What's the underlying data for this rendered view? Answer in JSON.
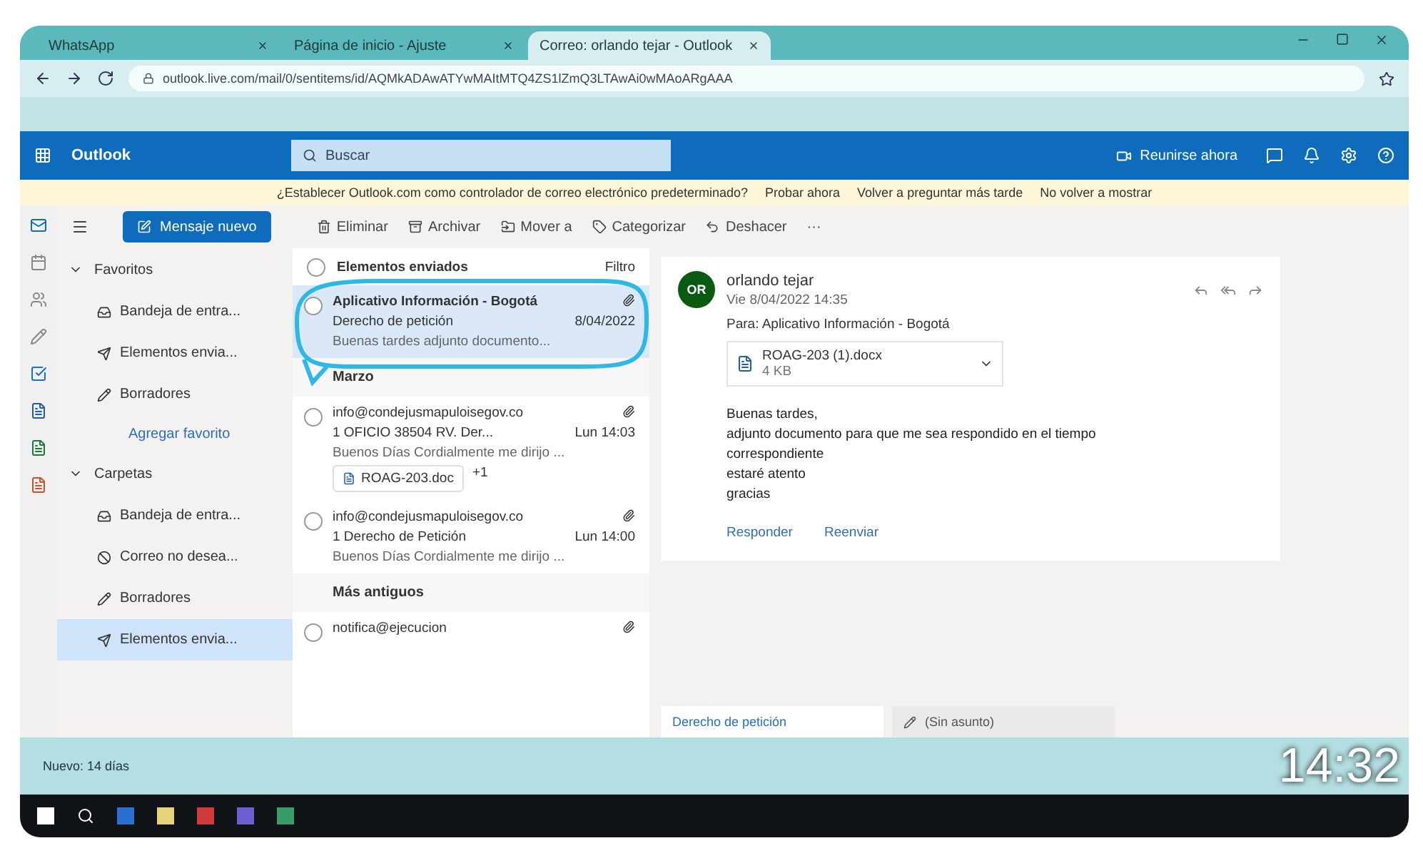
{
  "browser": {
    "tabs": [
      {
        "label": "WhatsApp",
        "selected": false
      },
      {
        "label": "Página de inicio - Ajuste",
        "selected": false
      },
      {
        "label": "Correo: orlando tejar - Outlook",
        "selected": true
      }
    ],
    "address": "outlook.live.com/mail/0/sentitems/id/AQMkADAwATYwMAItMTQ4ZS1lZmQ3LTAwAi0wMAoARgAAA"
  },
  "header": {
    "app_name": "Outlook",
    "search_placeholder": "Buscar",
    "meet_label": "Reunirse ahora"
  },
  "banner": {
    "message": "¿Establecer Outlook.com como controlador de correo electrónico predeterminado?",
    "actions": [
      "Probar ahora",
      "Volver a preguntar más tarde",
      "No volver a mostrar"
    ]
  },
  "toolbar": {
    "new_message": "Mensaje nuevo",
    "actions": [
      "Eliminar",
      "Archivar",
      "Mover a",
      "Categorizar",
      "Deshacer"
    ],
    "more": "···"
  },
  "folder_sections": [
    {
      "title": "Favoritos",
      "expanded": true,
      "items": [
        {
          "label": "Bandeja de entra...",
          "selected": false
        },
        {
          "label": "Elementos envia...",
          "selected": false
        },
        {
          "label": "Borradores",
          "selected": false
        }
      ],
      "link": "Agregar favorito"
    },
    {
      "title": "Carpetas",
      "expanded": true,
      "items": [
        {
          "label": "Bandeja de entra...",
          "selected": false
        },
        {
          "label": "Correo no desea...",
          "selected": false
        },
        {
          "label": "Borradores",
          "selected": false
        },
        {
          "label": "Elementos envia...",
          "selected": true
        }
      ]
    }
  ],
  "message_list": {
    "title": "Elementos enviados",
    "filter": "Filtro",
    "items": [
      {
        "kind": "message",
        "sender": "Aplicativo Información - Bogotá",
        "subject": "Derecho de petición",
        "date": "8/04/2022",
        "preview": "Buenas tardes adjunto documento...",
        "selected": true
      },
      {
        "kind": "group",
        "title": "Marzo"
      },
      {
        "kind": "message",
        "sender": "info@condejusmapuloisegov.co",
        "subject": "1 OFICIO 38504 RV. Der...",
        "date": "Lun 14:03",
        "preview": "Buenos Días Cordialmente me dirijo ...",
        "selected": false,
        "attachment": {
          "name": "ROAG-203.doc",
          "more": "+1"
        }
      },
      {
        "kind": "message",
        "sender": "info@condejusmapuloisegov.co",
        "subject": "1 Derecho de Petición",
        "date": "Lun 14:00",
        "preview": "Buenos Días Cordialmente me dirijo ...",
        "selected": false
      },
      {
        "kind": "group",
        "title": "Más antiguos"
      },
      {
        "kind": "message",
        "sender": "notifica@ejecucion",
        "selected": false
      }
    ]
  },
  "reading": {
    "avatar": "OR",
    "sender": "orlando tejar",
    "date": "Vie 8/04/2022 14:35",
    "to": "Para: Aplicativo Información - Bogotá",
    "attachment": {
      "name": "ROAG-203 (1).docx",
      "size": "4 KB"
    },
    "body": [
      "Buenas tardes,",
      "adjunto documento para que me sea respondido en el tiempo",
      "correspondiente",
      "estaré atento",
      "gracias"
    ],
    "actions": [
      "Responder",
      "Reenviar"
    ]
  },
  "compose_tabs": [
    {
      "label": "Derecho de petición",
      "selected": true
    },
    {
      "label": "(Sin asunto)",
      "selected": false
    }
  ],
  "status_bar": {
    "label": "Nuevo: 14 días"
  },
  "video": {
    "duration": "14:32"
  }
}
